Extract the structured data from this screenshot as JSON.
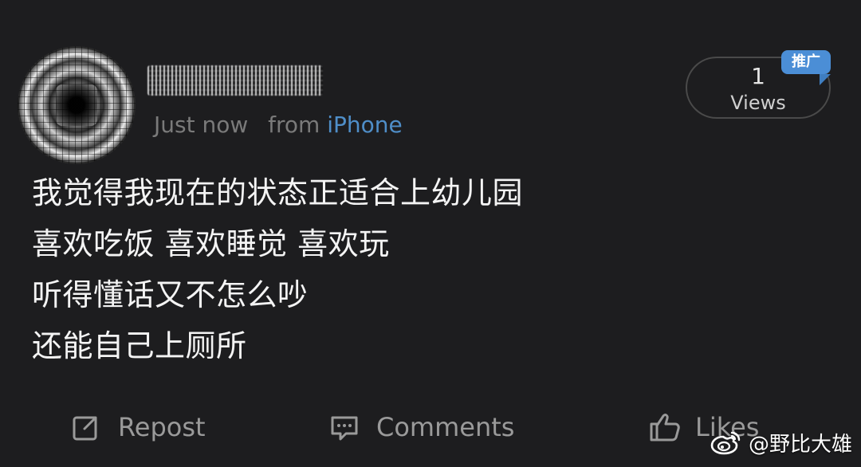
{
  "post": {
    "meta": {
      "time": "Just now",
      "source_prefix": "from",
      "platform": "iPhone"
    },
    "views": {
      "count": "1",
      "label": "Views",
      "badge": "推广"
    },
    "body_lines": [
      "我觉得我现在的状态正适合上幼儿园",
      "喜欢吃饭 喜欢睡觉 喜欢玩",
      "听得懂话又不怎么吵",
      "还能自己上厕所"
    ]
  },
  "actions": {
    "repost_label": "Repost",
    "comments_label": "Comments",
    "likes_label": "Likes"
  },
  "watermark": {
    "text": "@野比大雄"
  },
  "colors": {
    "background": "#1d1d1f",
    "primary_text": "#f4f4f4",
    "secondary_text": "#7a7a7a",
    "platform_link": "#4f8ec8",
    "badge": "#4b8ed6",
    "action_text": "#9a9a9a"
  },
  "icons": {
    "repost": "repost-icon",
    "comments": "comments-icon",
    "likes": "like-icon",
    "watermark": "weibo-logo-icon"
  }
}
